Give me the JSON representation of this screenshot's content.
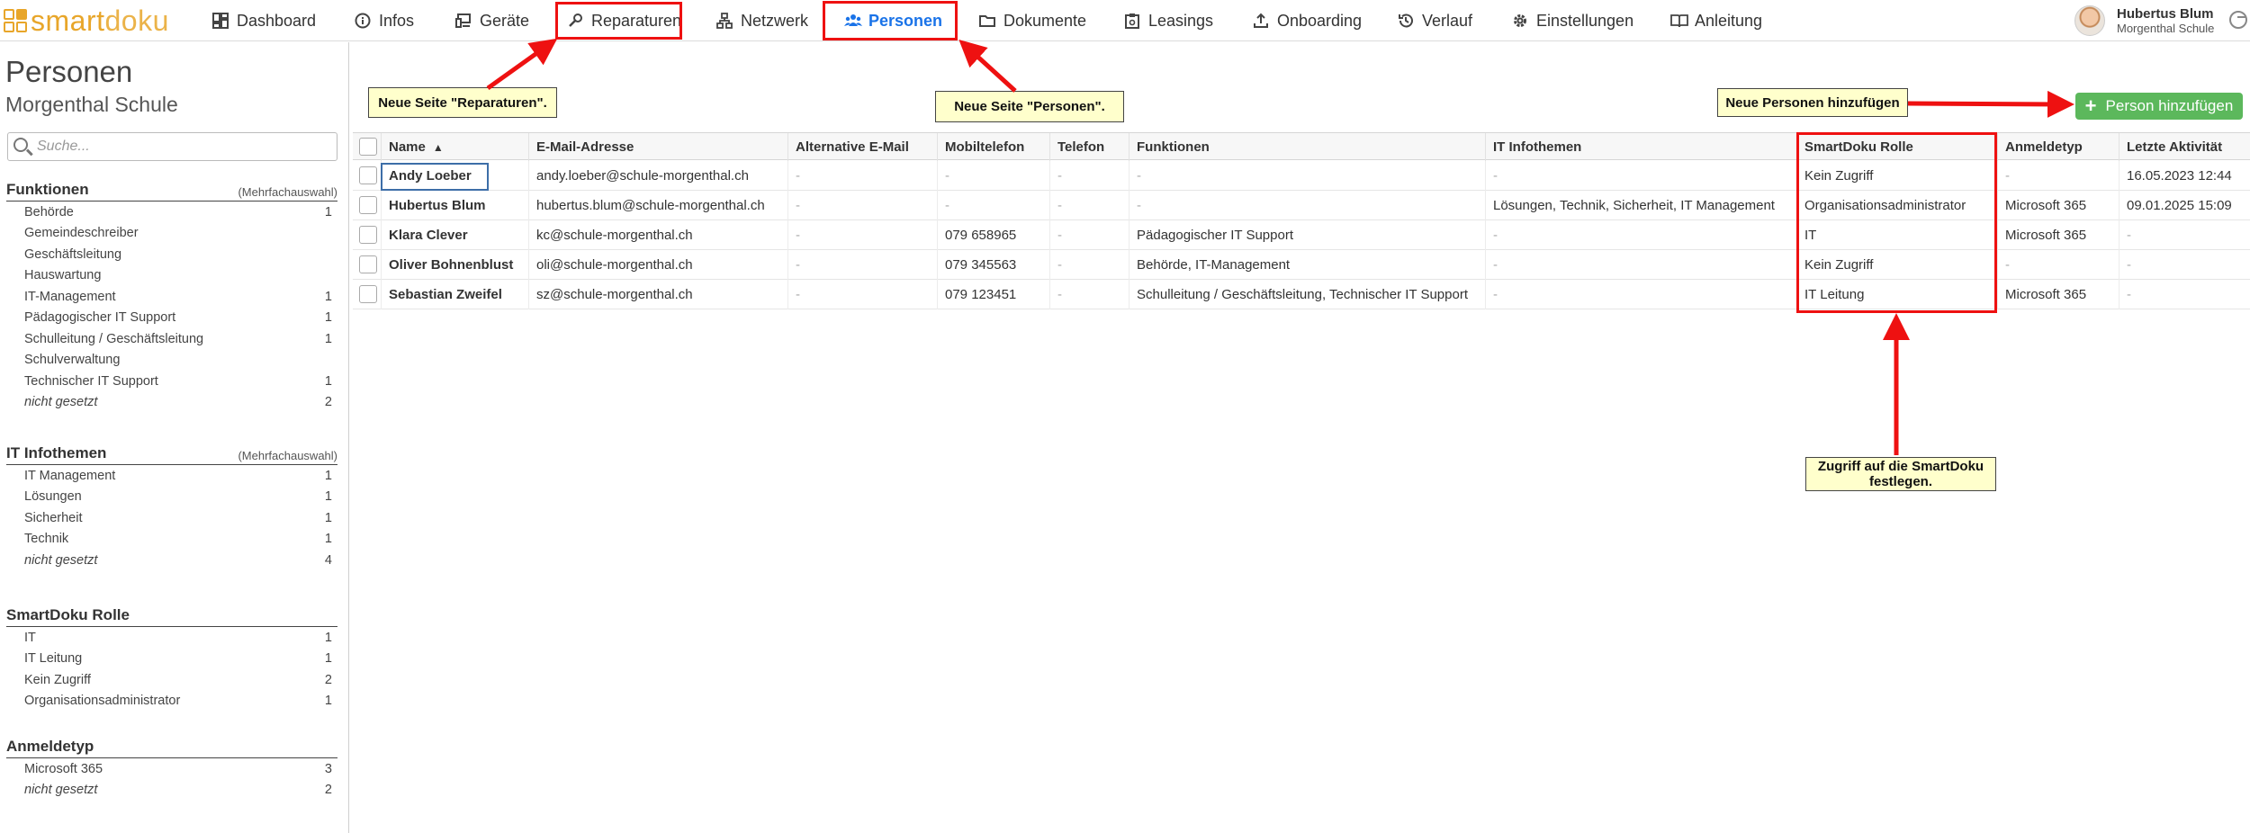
{
  "app": {
    "name_part1": "smart",
    "name_part2": "doku"
  },
  "nav": [
    {
      "label": "Dashboard",
      "icon": "dashboard-icon"
    },
    {
      "label": "Infos",
      "icon": "info-icon"
    },
    {
      "label": "Geräte",
      "icon": "devices-icon"
    },
    {
      "label": "Reparaturen",
      "icon": "wrench-icon"
    },
    {
      "label": "Netzwerk",
      "icon": "network-icon"
    },
    {
      "label": "Personen",
      "icon": "people-icon",
      "active": true
    },
    {
      "label": "Dokumente",
      "icon": "folder-icon"
    },
    {
      "label": "Leasings",
      "icon": "clipboard-icon"
    },
    {
      "label": "Onboarding",
      "icon": "upload-icon"
    },
    {
      "label": "Verlauf",
      "icon": "history-icon"
    },
    {
      "label": "Einstellungen",
      "icon": "gear-icon"
    },
    {
      "label": "Anleitung",
      "icon": "book-icon"
    }
  ],
  "user": {
    "name": "Hubertus Blum",
    "org": "Morgenthal Schule"
  },
  "page": {
    "title": "Personen",
    "subtitle": "Morgenthal Schule"
  },
  "search": {
    "placeholder": "Suche..."
  },
  "facets": [
    {
      "title": "Funktionen",
      "mode": "(Mehrfachauswahl)",
      "items": [
        {
          "label": "Behörde",
          "count": "1"
        },
        {
          "label": "Gemeindeschreiber",
          "count": ""
        },
        {
          "label": "Geschäftsleitung",
          "count": ""
        },
        {
          "label": "Hauswartung",
          "count": ""
        },
        {
          "label": "IT-Management",
          "count": "1"
        },
        {
          "label": "Pädagogischer IT Support",
          "count": "1"
        },
        {
          "label": "Schulleitung / Geschäftsleitung",
          "count": "1"
        },
        {
          "label": "Schulverwaltung",
          "count": ""
        },
        {
          "label": "Technischer IT Support",
          "count": "1"
        },
        {
          "label": "nicht gesetzt",
          "count": "2",
          "italic": true
        }
      ]
    },
    {
      "title": "IT Infothemen",
      "mode": "(Mehrfachauswahl)",
      "items": [
        {
          "label": "IT Management",
          "count": "1"
        },
        {
          "label": "Lösungen",
          "count": "1"
        },
        {
          "label": "Sicherheit",
          "count": "1"
        },
        {
          "label": "Technik",
          "count": "1"
        },
        {
          "label": "nicht gesetzt",
          "count": "4",
          "italic": true
        }
      ]
    },
    {
      "title": "SmartDoku Rolle",
      "mode": "",
      "items": [
        {
          "label": "IT",
          "count": "1"
        },
        {
          "label": "IT Leitung",
          "count": "1"
        },
        {
          "label": "Kein Zugriff",
          "count": "2"
        },
        {
          "label": "Organisationsadministrator",
          "count": "1"
        }
      ]
    },
    {
      "title": "Anmeldetyp",
      "mode": "",
      "items": [
        {
          "label": "Microsoft 365",
          "count": "3"
        },
        {
          "label": "nicht gesetzt",
          "count": "2",
          "italic": true
        }
      ]
    }
  ],
  "annotations": {
    "reparaturen": "Neue Seite \"Reparaturen\".",
    "personen": "Neue Seite \"Personen\".",
    "add": "Neue Personen hinzufügen",
    "role_line1": "Zugriff auf die SmartDoku",
    "role_line2": "festlegen."
  },
  "add_button": {
    "label": "Person hinzufügen"
  },
  "table": {
    "sort_indicator": "▲",
    "columns": [
      "Name",
      "E-Mail-Adresse",
      "Alternative E-Mail",
      "Mobiltelefon",
      "Telefon",
      "Funktionen",
      "IT Infothemen",
      "SmartDoku Rolle",
      "Anmeldetyp",
      "Letzte Aktivität"
    ],
    "rows": [
      [
        "Andy Loeber",
        "andy.loeber@schule-morgenthal.ch",
        "-",
        "-",
        "-",
        "-",
        "-",
        "Kein Zugriff",
        "-",
        "16.05.2023 12:44"
      ],
      [
        "Hubertus Blum",
        "hubertus.blum@schule-morgenthal.ch",
        "-",
        "-",
        "-",
        "-",
        "Lösungen, Technik, Sicherheit, IT Management",
        "Organisationsadministrator",
        "Microsoft 365",
        "09.01.2025 15:09"
      ],
      [
        "Klara Clever",
        "kc@schule-morgenthal.ch",
        "-",
        "079 658965",
        "-",
        "Pädagogischer IT Support",
        "-",
        "IT",
        "Microsoft 365",
        "-"
      ],
      [
        "Oliver Bohnenblust",
        "oli@schule-morgenthal.ch",
        "-",
        "079 345563",
        "-",
        "Behörde, IT-Management",
        "-",
        "Kein Zugriff",
        "-",
        "-"
      ],
      [
        "Sebastian Zweifel",
        "sz@schule-morgenthal.ch",
        "-",
        "079 123451",
        "-",
        "Schulleitung / Geschäftsleitung, Technischer IT Support",
        "-",
        "IT Leitung",
        "Microsoft 365",
        "-"
      ]
    ]
  },
  "colors": {
    "accent": "#1a73e8",
    "brand": "#e8a62a",
    "add_button": "#5cb85c",
    "highlight": "#ee1111",
    "note_bg": "#ffffcc"
  }
}
